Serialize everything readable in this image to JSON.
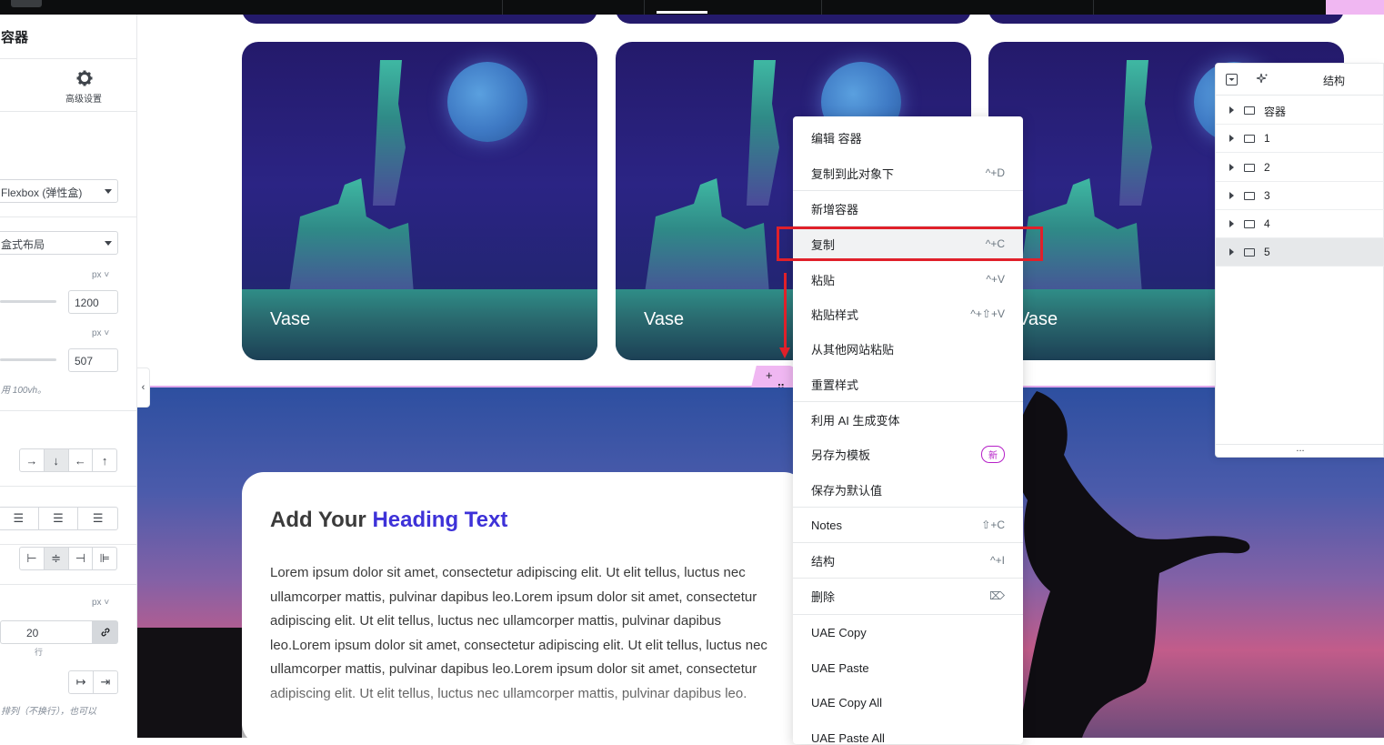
{
  "left_panel": {
    "title": "容器",
    "advanced_label": "高级设置",
    "display_select": "Flexbox (弹性盒)",
    "content_width_select": "盒式布局",
    "width_unit": "px",
    "width_value": "1200",
    "height_unit": "px",
    "height_value": "507",
    "height_note": "用 100vh。",
    "direction_buttons": [
      "→",
      "↓",
      "←",
      "↑"
    ],
    "gap_unit": "px",
    "gap_value": "20",
    "gap_row_label": "行",
    "wrap_note": "排列（不换行），也可以",
    "collapse_label": "‹"
  },
  "cards": [
    {
      "label": "Vase"
    },
    {
      "label": "Vase"
    },
    {
      "label": "Vase"
    }
  ],
  "hero": {
    "heading_prefix": "Add Your ",
    "heading_highlight": "Heading Text",
    "body": "Lorem ipsum dolor sit amet, consectetur adipiscing elit. Ut elit tellus, luctus nec ullamcorper mattis, pulvinar dapibus leo.Lorem ipsum dolor sit amet, consectetur adipiscing elit. Ut elit tellus, luctus nec ullamcorper mattis, pulvinar dapibus leo.Lorem ipsum dolor sit amet, consectetur adipiscing elit. Ut elit tellus, luctus nec ullamcorper mattis, pulvinar dapibus leo.Lorem ipsum dolor sit amet, consectetur adipiscing elit. Ut elit tellus, luctus nec ullamcorper mattis, pulvinar dapibus leo."
  },
  "handle": {
    "add": "+",
    "drag": "⠿"
  },
  "context_menu": {
    "items": [
      {
        "label": "编辑 容器",
        "shortcut": ""
      },
      {
        "label": "复制到此对象下",
        "shortcut": "^+D"
      },
      {
        "label": "新增容器",
        "shortcut": ""
      },
      {
        "label": "复制",
        "shortcut": "^+C"
      },
      {
        "label": "粘贴",
        "shortcut": "^+V"
      },
      {
        "label": "粘贴样式",
        "shortcut": "^+⇧+V"
      },
      {
        "label": "从其他网站粘贴",
        "shortcut": ""
      },
      {
        "label": "重置样式",
        "shortcut": ""
      },
      {
        "label": "利用 AI 生成变体",
        "shortcut": ""
      },
      {
        "label": "另存为模板",
        "shortcut": ""
      },
      {
        "label": "保存为默认值",
        "shortcut": ""
      },
      {
        "label": "Notes",
        "shortcut": "⇧+C"
      },
      {
        "label": "结构",
        "shortcut": "^+I"
      },
      {
        "label": "删除",
        "shortcut": "⌦"
      },
      {
        "label": "UAE Copy",
        "shortcut": ""
      },
      {
        "label": "UAE Paste",
        "shortcut": ""
      },
      {
        "label": "UAE Copy All",
        "shortcut": ""
      },
      {
        "label": "UAE Paste All",
        "shortcut": ""
      }
    ],
    "new_badge": "新"
  },
  "structure_panel": {
    "title": "结构",
    "rows": [
      "容器",
      "1",
      "2",
      "3",
      "4",
      "5"
    ],
    "footer": "..."
  },
  "colors": {
    "accent_heading": "#3e32d8",
    "highlight_box": "#e0202a",
    "handle_pink": "#f0b7f2",
    "badge_purple": "#b620c8"
  }
}
